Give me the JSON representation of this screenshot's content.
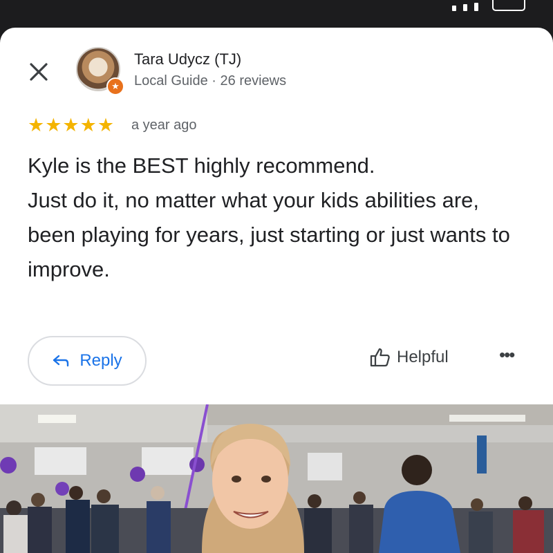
{
  "review": {
    "author_name": "Tara Udycz (TJ)",
    "author_meta": "Local Guide · 26 reviews",
    "rating_stars": "★★★★★",
    "time_ago": "a year ago",
    "text": "Kyle is the BEST highly recommend.\nJust do it, no matter what your kids abilities are,\nbeen playing for years, just starting or just wants to  improve."
  },
  "actions": {
    "reply_label": "Reply",
    "helpful_label": "Helpful",
    "more_label": "•••"
  },
  "icons": {
    "close": "close-icon",
    "reply": "reply-arrow-icon",
    "helpful": "thumbs-up-icon",
    "badge": "local-guide-star-icon"
  },
  "colors": {
    "accent": "#1a73e8",
    "star": "#f4b400",
    "badge": "#e8711c"
  }
}
